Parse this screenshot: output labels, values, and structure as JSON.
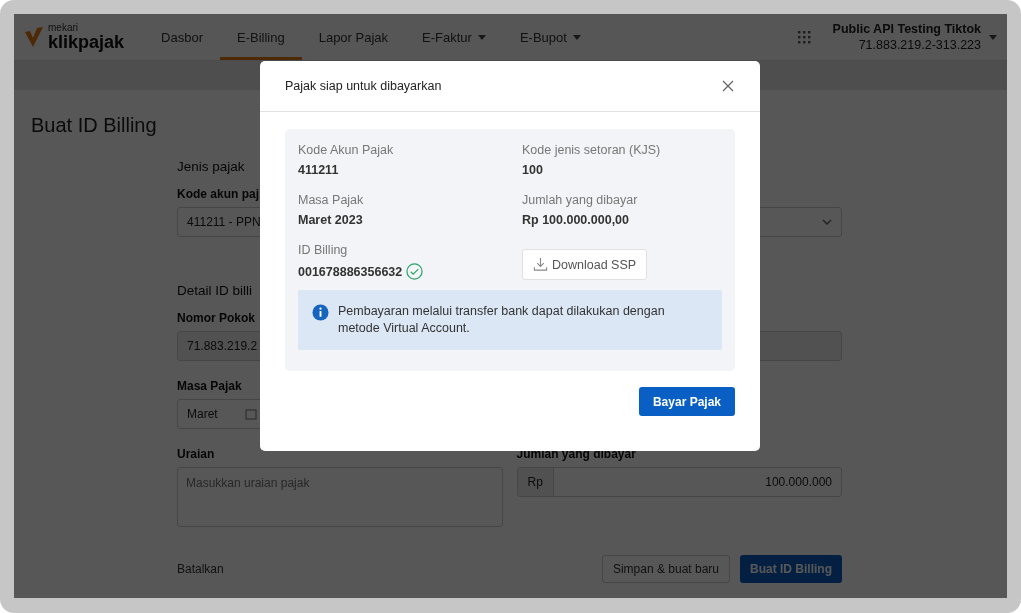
{
  "brand": {
    "tagline": "mekari",
    "name": "klikpajak"
  },
  "nav": [
    {
      "label": "Dasbor",
      "selected": false,
      "dropdown": false
    },
    {
      "label": "E-Billing",
      "selected": true,
      "dropdown": false
    },
    {
      "label": "Lapor Pajak",
      "selected": false,
      "dropdown": false
    },
    {
      "label": "E-Faktur",
      "selected": false,
      "dropdown": true
    },
    {
      "label": "E-Bupot",
      "selected": false,
      "dropdown": true
    }
  ],
  "account": {
    "name": "Public API Testing Tiktok",
    "npwp": "71.883.219.2-313.223"
  },
  "page": {
    "title": "Buat ID Billing",
    "section_1": {
      "heading": "Jenis pajak",
      "label": "Kode akun paj",
      "value": "411211 - PPN"
    },
    "section_2": {
      "heading": "Detail ID billi",
      "label": "Nomor Pokok",
      "value": "71.883.219.2"
    },
    "masa_pajak": {
      "label": "Masa Pajak",
      "value": "Maret"
    },
    "uraian": {
      "label": "Uraian",
      "placeholder": "Masukkan uraian pajak"
    },
    "jumlah": {
      "label": "Jumlah yang dibayar",
      "prefix": "Rp",
      "value": "100.000.000"
    },
    "cancel": "Batalkan",
    "save_new": "Simpan & buat baru",
    "submit": "Buat ID Billing"
  },
  "modal": {
    "title": "Pajak siap untuk dibayarkan",
    "fields": [
      {
        "label": "Kode Akun Pajak",
        "value": "411211"
      },
      {
        "label": "Kode jenis setoran (KJS)",
        "value": "100"
      },
      {
        "label": "Masa Pajak",
        "value": "Maret 2023"
      },
      {
        "label": "Jumlah yang dibayar",
        "value": "Rp 100.000.000,00"
      }
    ],
    "billing": {
      "label": "ID Billing",
      "value": "001678886356632",
      "verified": true
    },
    "download": "Download SSP",
    "info": "Pembayaran melalui transfer bank dapat dilakukan dengan metode Virtual Account.",
    "pay": "Bayar Pajak"
  }
}
